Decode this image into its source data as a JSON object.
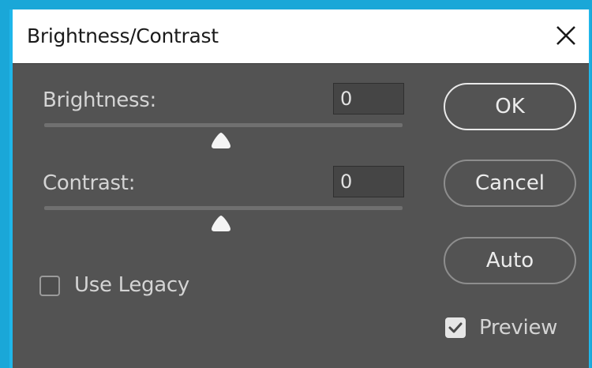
{
  "window": {
    "title": "Brightness/Contrast",
    "close_icon": "close-icon"
  },
  "brightness": {
    "label": "Brightness:",
    "value": "0",
    "slider_position_pct": 50
  },
  "contrast": {
    "label": "Contrast:",
    "value": "0",
    "slider_position_pct": 50
  },
  "legacy": {
    "label": "Use Legacy",
    "checked": false
  },
  "preview": {
    "label": "Preview",
    "checked": true
  },
  "buttons": {
    "ok": "OK",
    "cancel": "Cancel",
    "auto": "Auto"
  },
  "colors": {
    "accent": "#1aa7d8",
    "panel": "#535353",
    "titlebar": "#ffffff"
  }
}
